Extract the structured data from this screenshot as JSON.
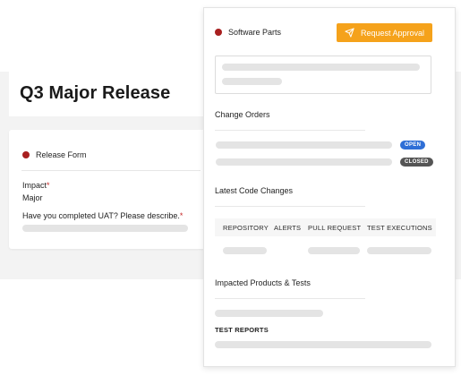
{
  "page": {
    "title": "Q3 Major Release"
  },
  "release_form": {
    "header": "Release Form",
    "impact_label": "Impact",
    "impact_value": "Major",
    "uat_label": "Have you completed UAT? Please describe.",
    "required_mark": "*"
  },
  "panel": {
    "header": "Software Parts",
    "request_button": "Request Approval",
    "change_orders_title": "Change Orders",
    "change_orders": [
      {
        "status": "OPEN"
      },
      {
        "status": "CLOSED"
      }
    ],
    "latest_code_title": "Latest Code Changes",
    "columns": [
      "REPOSITORY",
      "ALERTS",
      "PULL REQUEST",
      "TEST EXECUTIONS"
    ],
    "impacted_title": "Impacted Products & Tests",
    "test_reports_label": "TEST REPORTS"
  },
  "colors": {
    "accent": "#f5a21b",
    "status_dot": "#a81f1f",
    "open_badge": "#2f6fd6",
    "closed_badge": "#555555"
  },
  "icons": {
    "section_marker": "status-dot",
    "approve": "send-icon"
  }
}
